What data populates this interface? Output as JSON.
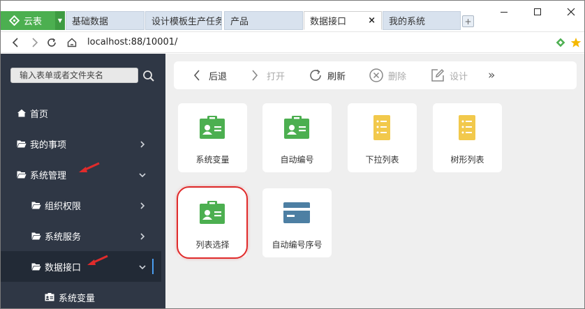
{
  "app": {
    "name": "云表",
    "brand_color": "#4caf50"
  },
  "tabs": [
    {
      "label": "基础数据",
      "active": false
    },
    {
      "label": "设计模板生产任务",
      "active": false
    },
    {
      "label": "产品",
      "active": false
    },
    {
      "label": "数据接口",
      "active": true,
      "close": "×"
    },
    {
      "label": "我的系统",
      "active": false
    }
  ],
  "address": {
    "url": "localhost:88/10001/"
  },
  "sidebar": {
    "search_placeholder": "输入表单或者文件夹名",
    "items": [
      {
        "label": "首页",
        "icon": "home-icon"
      },
      {
        "label": "我的事项",
        "icon": "folder-icon"
      },
      {
        "label": "系统管理",
        "icon": "folder-icon"
      },
      {
        "label": "组织权限",
        "icon": "folder-icon"
      },
      {
        "label": "系统服务",
        "icon": "folder-icon"
      },
      {
        "label": "数据接口",
        "icon": "folder-icon"
      },
      {
        "label": "系统变量",
        "icon": "id-card-icon"
      }
    ]
  },
  "toolbar": {
    "back": "后退",
    "open": "打开",
    "refresh": "刷新",
    "delete": "删除",
    "design": "设计",
    "more": "»"
  },
  "cards": [
    {
      "label": "系统变量",
      "icon": "id-card-icon",
      "color": "#4caf50"
    },
    {
      "label": "自动编号",
      "icon": "id-card-icon",
      "color": "#4caf50"
    },
    {
      "label": "下拉列表",
      "icon": "list-doc-icon",
      "color": "#f2c94c"
    },
    {
      "label": "树形列表",
      "icon": "list-doc-icon",
      "color": "#f2c94c"
    },
    {
      "label": "列表选择",
      "icon": "id-card-icon",
      "color": "#4caf50"
    },
    {
      "label": "自动编号序号",
      "icon": "card-window-icon",
      "color": "#4d7fa3"
    }
  ]
}
